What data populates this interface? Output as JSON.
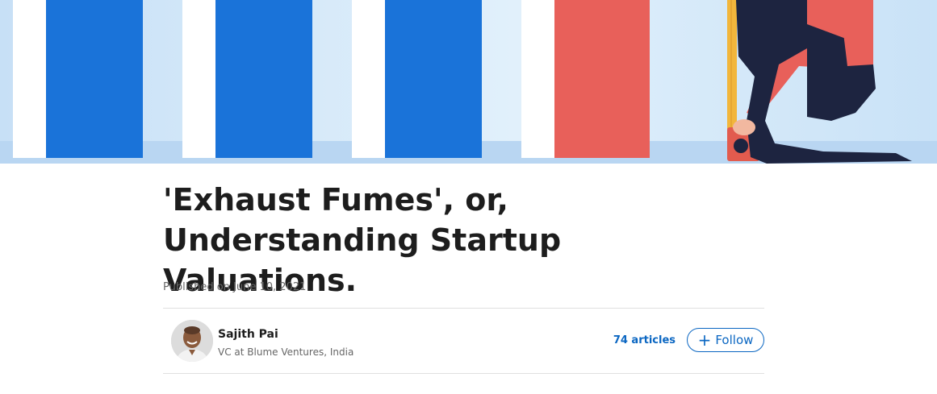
{
  "article": {
    "title": "'Exhaust Fumes', or, Understanding Startup Valuations.",
    "published": "Published on June 10, 2021"
  },
  "author": {
    "name": "Sajith Pai",
    "headline": "VC at Blume Ventures, India",
    "articles_count": "74 articles",
    "follow_label": "Follow"
  },
  "icons": {
    "follow": "plus-icon"
  },
  "colors": {
    "accent": "#0a66c2",
    "hero_bar_blue": "#1a73d9",
    "hero_bar_red": "#e8605a",
    "hero_background": "#cfe5f8"
  }
}
